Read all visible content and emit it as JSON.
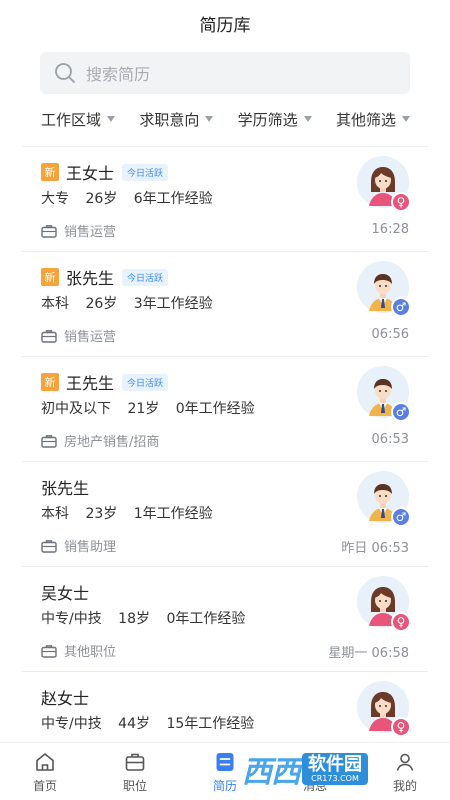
{
  "header": {
    "title": "简历库"
  },
  "search": {
    "placeholder": "搜索简历"
  },
  "filters": [
    "工作区域",
    "求职意向",
    "学历筛选",
    "其他筛选"
  ],
  "resumes": [
    {
      "new_badge": "新",
      "name": "王女士",
      "active": "今日活跃",
      "education": "大专",
      "age": "26岁",
      "experience": "6年工作经验",
      "job": "销售运营",
      "time": "16:28",
      "gender": "female",
      "gender_symbol": "♀"
    },
    {
      "new_badge": "新",
      "name": "张先生",
      "active": "今日活跃",
      "education": "本科",
      "age": "26岁",
      "experience": "3年工作经验",
      "job": "销售运营",
      "time": "06:56",
      "gender": "male",
      "gender_symbol": "♂"
    },
    {
      "new_badge": "新",
      "name": "王先生",
      "active": "今日活跃",
      "education": "初中及以下",
      "age": "21岁",
      "experience": "0年工作经验",
      "job": "房地产销售/招商",
      "time": "06:53",
      "gender": "male",
      "gender_symbol": "♂"
    },
    {
      "new_badge": "",
      "name": "张先生",
      "active": "",
      "education": "本科",
      "age": "23岁",
      "experience": "1年工作经验",
      "job": "销售助理",
      "time": "昨日 06:53",
      "gender": "male",
      "gender_symbol": "♂"
    },
    {
      "new_badge": "",
      "name": "吴女士",
      "active": "",
      "education": "中专/中技",
      "age": "18岁",
      "experience": "0年工作经验",
      "job": "其他职位",
      "time": "星期一 06:58",
      "gender": "female",
      "gender_symbol": "♀"
    },
    {
      "new_badge": "",
      "name": "赵女士",
      "active": "",
      "education": "中专/中技",
      "age": "44岁",
      "experience": "15年工作经验",
      "job": "",
      "time": "",
      "gender": "female",
      "gender_symbol": "♀"
    }
  ],
  "tabbar": {
    "items": [
      {
        "label": "首页",
        "icon": "home-icon"
      },
      {
        "label": "职位",
        "icon": "briefcase-icon"
      },
      {
        "label": "简历",
        "icon": "resume-icon",
        "active": true
      },
      {
        "label": "消息",
        "icon": "message-icon"
      },
      {
        "label": "我的",
        "icon": "profile-icon"
      }
    ]
  },
  "watermark": {
    "logo": "西西",
    "box": "软件园",
    "sub": "CR173.COM"
  },
  "colors": {
    "accent": "#3a7ff0",
    "new_badge": "#f5a33a",
    "female": "#e8547a",
    "male": "#5b7fe0"
  }
}
